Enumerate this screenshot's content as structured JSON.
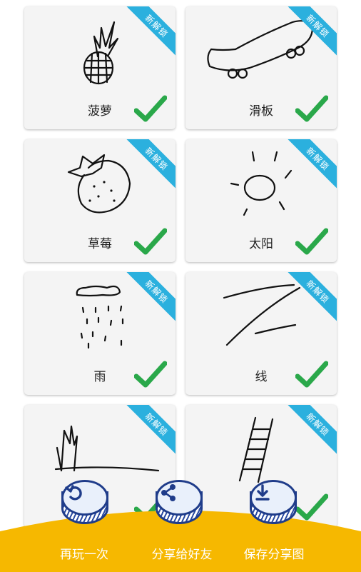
{
  "cards": [
    {
      "label": "菠萝",
      "badge": "新解锁",
      "drawing": "pineapple-drawing",
      "status": "unlocked"
    },
    {
      "label": "滑板",
      "badge": "新解锁",
      "drawing": "skateboard-drawing",
      "status": "unlocked"
    },
    {
      "label": "草莓",
      "badge": "新解锁",
      "drawing": "strawberry-drawing",
      "status": "unlocked"
    },
    {
      "label": "太阳",
      "badge": "新解锁",
      "drawing": "sun-drawing",
      "status": "unlocked"
    },
    {
      "label": "雨",
      "badge": "新解锁",
      "drawing": "rain-drawing",
      "status": "unlocked"
    },
    {
      "label": "线",
      "badge": "新解锁",
      "drawing": "line-drawing",
      "status": "unlocked"
    },
    {
      "label": "",
      "badge": "新解锁",
      "drawing": "grass-drawing",
      "status": "unlocked"
    },
    {
      "label": "",
      "badge": "新解锁",
      "drawing": "ladder-drawing",
      "status": "unlocked"
    }
  ],
  "footer": {
    "replay_label": "再玩一次",
    "share_label": "分享给好友",
    "save_label": "保存分享图",
    "icons": [
      "replay-icon",
      "share-icon",
      "download-icon"
    ]
  },
  "colors": {
    "ribbon": "#2bb0de",
    "check": "#2aa84a",
    "footer_bg": "#f6b800",
    "button_outline": "#1f3c8a"
  }
}
